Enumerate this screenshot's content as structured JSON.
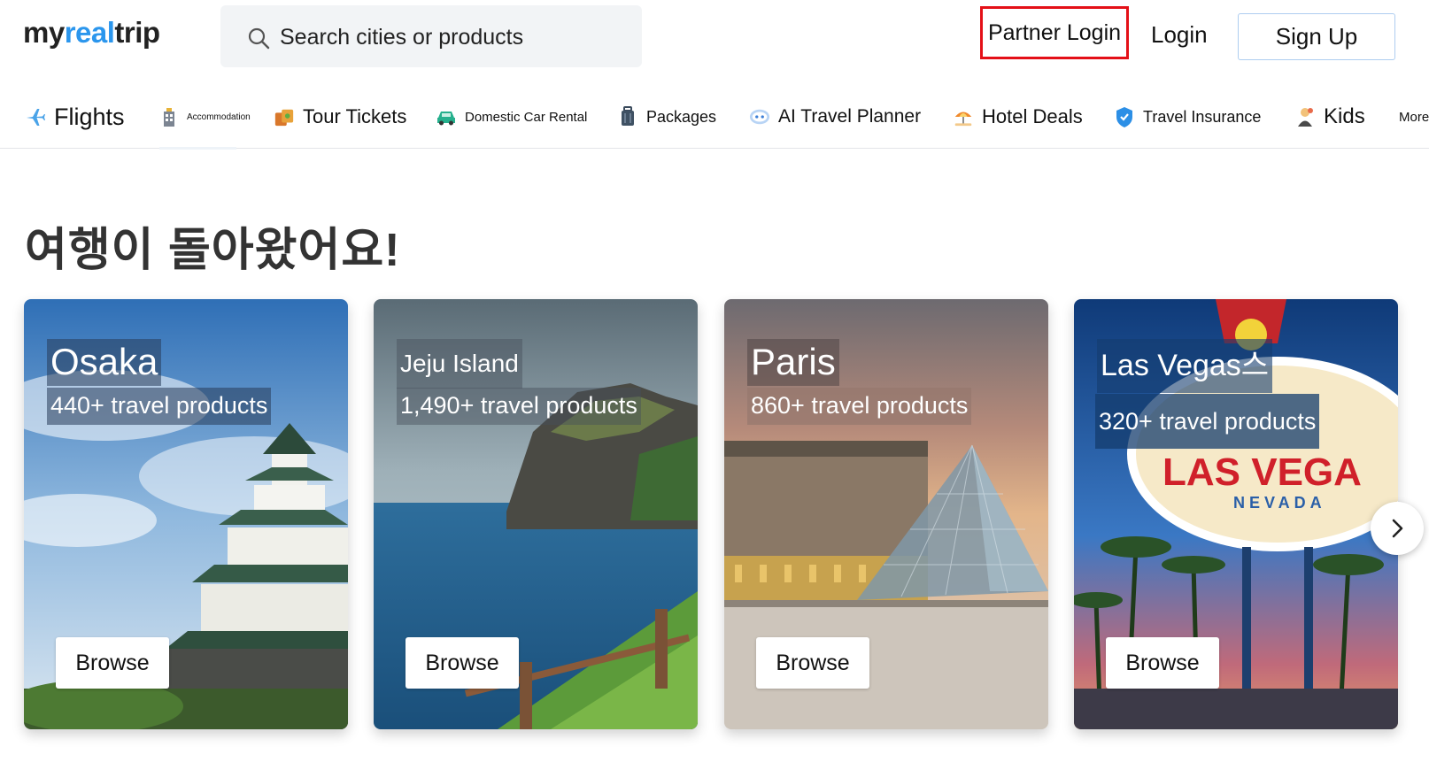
{
  "header": {
    "logo": {
      "part1": "my",
      "part2": "real",
      "part3": "trip"
    },
    "search": {
      "placeholder": "Search cities or products"
    },
    "partner_login": "Partner Login",
    "login": "Login",
    "signup": "Sign Up"
  },
  "nav": {
    "items": [
      {
        "label": "Flights",
        "icon": "airplane-icon"
      },
      {
        "label": "Accommodation",
        "icon": "hotel-building-icon"
      },
      {
        "label": "Tour Tickets",
        "icon": "tickets-icon"
      },
      {
        "label": "Domestic Car Rental",
        "icon": "car-icon"
      },
      {
        "label": "Packages",
        "icon": "luggage-icon"
      },
      {
        "label": "AI Travel Planner",
        "icon": "ai-robot-icon"
      },
      {
        "label": "Hotel Deals",
        "icon": "beach-umbrella-icon"
      },
      {
        "label": "Travel Insurance",
        "icon": "shield-icon"
      },
      {
        "label": "Kids",
        "icon": "kids-icon"
      },
      {
        "label": "More",
        "icon": ""
      }
    ]
  },
  "main": {
    "title": "여행이 돌아왔어요!",
    "cards": [
      {
        "city": "Osaka",
        "count": "440+ travel products",
        "browse": "Browse"
      },
      {
        "city": "Jeju Island",
        "count": "1,490+ travel products",
        "browse": "Browse"
      },
      {
        "city": "Paris",
        "count": "860+ travel products",
        "browse": "Browse"
      },
      {
        "city": "Las Vegas스",
        "count": "320+ travel products",
        "browse": "Browse"
      }
    ]
  },
  "colors": {
    "brand_accent": "#2b96ed",
    "partner_outline": "#e41017",
    "signup_border": "#aecdf0",
    "search_bg": "#f2f4f6"
  }
}
